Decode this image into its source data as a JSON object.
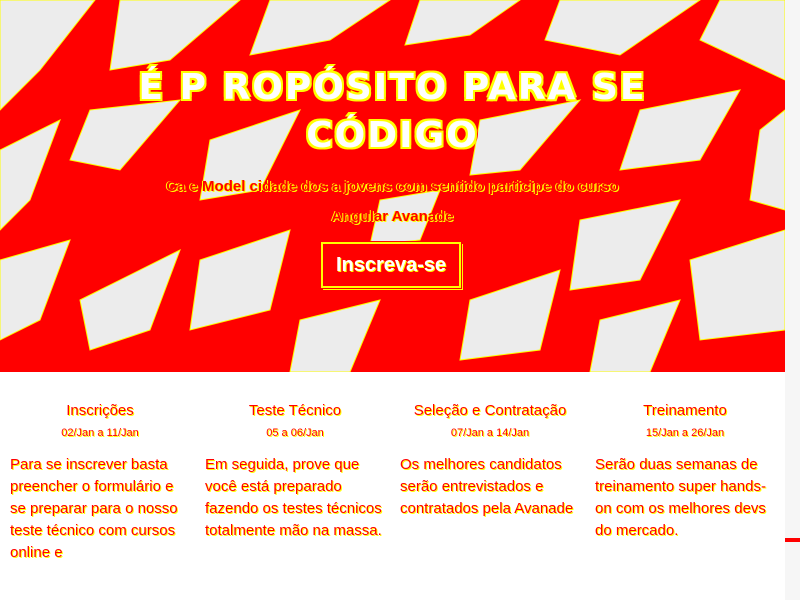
{
  "hero": {
    "title": "É P ROPÓSITO PARA SE CÓDIGO",
    "subtitle_line1": "Ca e Model cidade dos a jovens com sentido participe do curso",
    "subtitle_line2": "Angular Avanade",
    "cta_label": "Inscreva-se"
  },
  "steps": [
    {
      "title": "Inscrições",
      "date": "02/Jan a 11/Jan",
      "description": "Para se inscrever basta preencher o formulário e se preparar para o nosso teste técnico com cursos online e"
    },
    {
      "title": "Teste Técnico",
      "date": "05 a 06/Jan",
      "description": "Em seguida, prove que você está preparado fazendo os testes técnicos totalmente mão na massa."
    },
    {
      "title": "Seleção e Contratação",
      "date": "07/Jan a 14/Jan",
      "description": "Os melhores candidatos serão entrevistados e contratados pela Avanade"
    },
    {
      "title": "Treinamento",
      "date": "15/Jan a 26/Jan",
      "description": "Serão duas semanas de treinamento super hands-on com os melhores devs do mercado."
    }
  ],
  "colors": {
    "accent": "#ff0000",
    "highlight": "#ffff00",
    "background": "#ffffff",
    "pattern_light": "#ececec"
  }
}
